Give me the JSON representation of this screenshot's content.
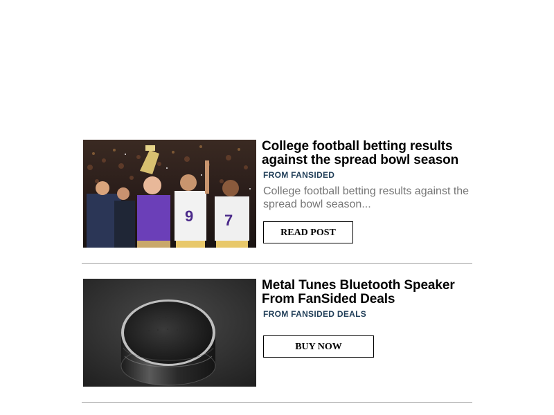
{
  "posts": [
    {
      "title": "College football betting results against the spread bowl season",
      "source": "FROM FANSIDED",
      "excerpt": "College football betting results against the spread bowl season...",
      "button_label": "READ POST",
      "image": "football-trophy-celebration-photo"
    },
    {
      "title": "Metal Tunes Bluetooth Speaker From FanSided Deals",
      "source": "FROM FANSIDED DEALS",
      "button_label": "BUY NOW",
      "image": "bluetooth-speaker-photo"
    }
  ]
}
